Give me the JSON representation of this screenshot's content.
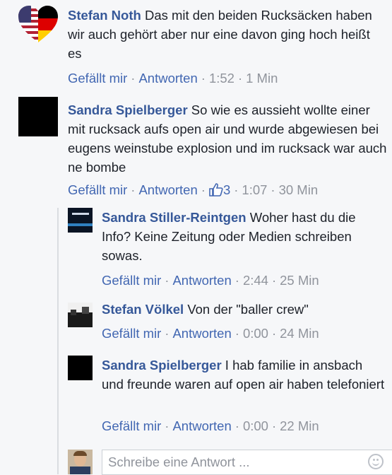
{
  "comments": [
    {
      "author": "Stefan Noth",
      "text": "Das mit den beiden Rucksäcken haben wir auch gehört aber nur eine davon ging hoch heißt es",
      "like_label": "Gefällt mir",
      "reply_label": "Antworten",
      "time": "1:52",
      "age": "1 Min"
    },
    {
      "author": "Sandra Spielberger",
      "text": "So wie es aussieht wollte einer mit rucksack aufs open air und wurde abgewiesen bei eugens weinstube explosion und im rucksack war auch ne bombe",
      "like_label": "Gefällt mir",
      "reply_label": "Antworten",
      "likes": "3",
      "time": "1:07",
      "age": "30 Min"
    }
  ],
  "replies": [
    {
      "author": "Sandra Stiller-Reintgen",
      "text": "Woher hast du die Info? Keine Zeitung oder Medien schreiben sowas.",
      "like_label": "Gefällt mir",
      "reply_label": "Antworten",
      "time": "2:44",
      "age": "25 Min"
    },
    {
      "author": "Stefan Völkel",
      "text": "Von der \"baller crew\"",
      "like_label": "Gefällt mir",
      "reply_label": "Antworten",
      "time": "0:00",
      "age": "24 Min"
    },
    {
      "author": "Sandra Spielberger",
      "text": "I hab familie in ansbach und freunde waren auf open air haben telefoniert",
      "like_label": "Gefällt mir",
      "reply_label": "Antworten",
      "time": "0:00",
      "age": "22 Min"
    }
  ],
  "reply_box": {
    "placeholder": "Schreibe eine Antwort ..."
  },
  "icons": {
    "like": "thumbs-up-icon",
    "emoji": "smiley-icon"
  },
  "colors": {
    "link": "#4267b2",
    "author": "#365899",
    "meta": "#90949c"
  }
}
